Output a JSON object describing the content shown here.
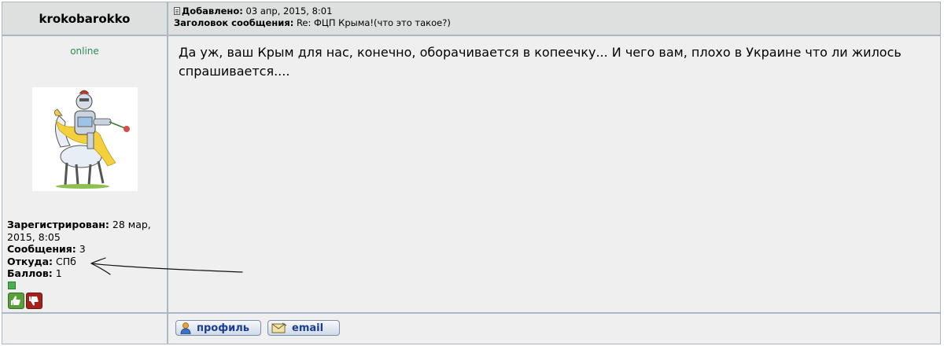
{
  "post": {
    "author": "krokobarokko",
    "status": "online",
    "added_label": "Добавлено:",
    "added_value": " 03 апр, 2015, 8:01",
    "subject_label": "Заголовок сообщения:",
    "subject_value": " Re: ФЦП Крыма!(что это такое?)",
    "body": "Да уж, ваш Крым для нас, конечно, оборачивается в копеечку... И чего вам, плохо в Украине что ли жилось спрашивается...."
  },
  "profile": {
    "registered_label": "Зарегистрирован:",
    "registered_value": " 28 мар, 2015, 8:05",
    "messages_label": "Сообщения:",
    "messages_value": " 3",
    "from_label": "Откуда:",
    "from_value": " СПб",
    "points_label": "Баллов:",
    "points_value": " 1"
  },
  "buttons": {
    "profile": "профиль",
    "email": "email"
  },
  "icons": {
    "post": "post-icon",
    "thumb_up": "thumbs-up-icon",
    "thumb_down": "thumbs-down-icon",
    "profile": "user-icon",
    "email": "envelope-icon"
  },
  "colors": {
    "status_online": "#2e8b57",
    "link_button_text": "#1b3d8f",
    "thumb_up": "#5a9e3c",
    "thumb_down": "#a3221c"
  }
}
